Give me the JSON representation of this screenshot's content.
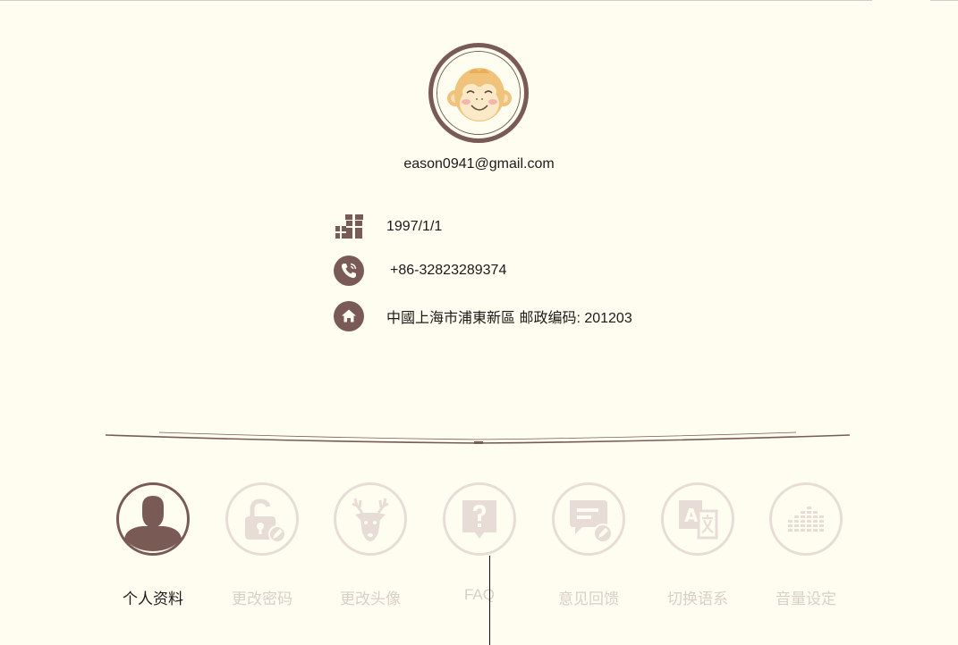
{
  "profile": {
    "email": "eason0941@gmail.com",
    "birthday": "1997/1/1",
    "phone": "+86-32823289374",
    "address": "中國上海市浦東新區 邮政编码: 201203"
  },
  "icons": {
    "birthday": "gift-icon",
    "phone": "phone-icon",
    "address": "home-icon"
  },
  "tabs": [
    {
      "label": "个人资料",
      "icon": "person-icon",
      "active": true
    },
    {
      "label": "更改密码",
      "icon": "unlock-edit-icon",
      "active": false
    },
    {
      "label": "更改头像",
      "icon": "deer-icon",
      "active": false
    },
    {
      "label": "FAQ",
      "icon": "question-icon",
      "active": false
    },
    {
      "label": "意见回馈",
      "icon": "chat-edit-icon",
      "active": false
    },
    {
      "label": "切换语系",
      "icon": "translate-icon",
      "active": false
    },
    {
      "label": "音量设定",
      "icon": "equalizer-icon",
      "active": false
    }
  ],
  "colors": {
    "background": "#fffdf0",
    "accent": "#7a5a55",
    "inactive": "#e8ddd6"
  }
}
